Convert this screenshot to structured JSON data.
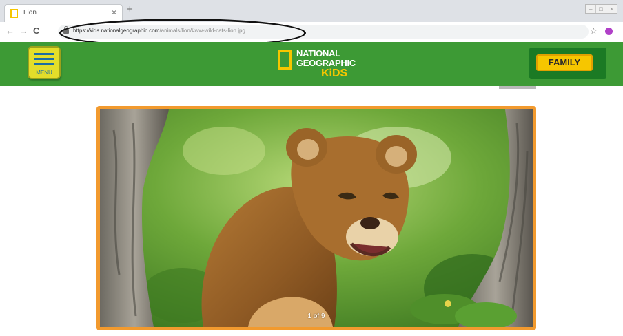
{
  "browser": {
    "tab_title": "Lion",
    "tab_close": "×",
    "new_tab": "+",
    "back": "←",
    "forward": "→",
    "reload": "C",
    "url_host": "https://kids.nationalgeographic.com",
    "url_path": "/animals/lion/#ww-wild-cats-lion.jpg",
    "star": "☆",
    "extension_color": "#b040c8"
  },
  "header": {
    "menu_label": "MENU",
    "logo_line1": "NATIONAL",
    "logo_line2": "GEOGRAPHIC",
    "logo_line3": "KiDS",
    "family_label": "FAMILY",
    "colors": {
      "header_green": "#3d9a35",
      "menu_yellow": "#e3de2a",
      "logo_yellow": "#f6c600",
      "family_bg": "#1b7a24"
    }
  },
  "gallery": {
    "image_icon": "lion-cub-photo",
    "counter": "1 of 9",
    "border_color": "#f29a2e"
  }
}
